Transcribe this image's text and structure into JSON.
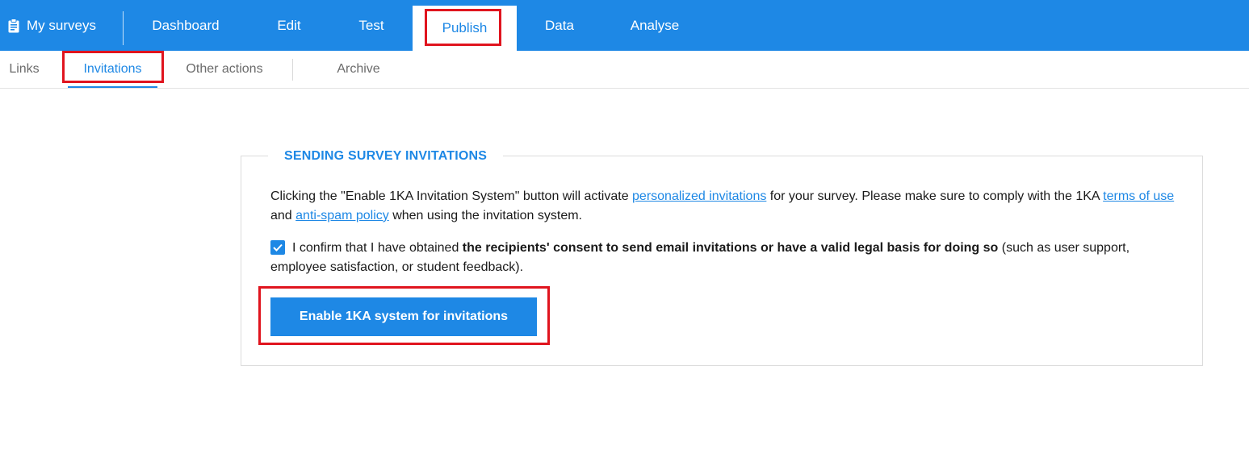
{
  "header": {
    "brand_label": "My surveys",
    "tabs": [
      {
        "label": "Dashboard"
      },
      {
        "label": "Edit"
      },
      {
        "label": "Test"
      },
      {
        "label": "Publish",
        "active": true
      },
      {
        "label": "Data"
      },
      {
        "label": "Analyse"
      }
    ]
  },
  "subnav": {
    "tabs": [
      {
        "label": "Links"
      },
      {
        "label": "Invitations",
        "active": true
      },
      {
        "label": "Other actions"
      },
      {
        "label": "Archive"
      }
    ]
  },
  "section": {
    "title": "SENDING SURVEY INVITATIONS",
    "para_part1": "Clicking the \"Enable 1KA Invitation System\" button will activate ",
    "link_personalized": "personalized invitations",
    "para_part2": " for your survey. Please make sure to comply with the 1KA ",
    "link_terms": "terms of use",
    "para_part3": " and ",
    "link_antispam": "anti-spam policy",
    "para_part4": " when using the invitation system.",
    "consent_checked": true,
    "consent_part1": "I confirm that I have obtained ",
    "consent_bold": "the recipients' consent to send email invitations or have a valid legal basis for doing so",
    "consent_part2": " (such as user support, employee satisfaction, or student feedback).",
    "button_label": "Enable 1KA system for invitations"
  },
  "colors": {
    "accent": "#1e88e5",
    "highlight": "#e0141e"
  }
}
